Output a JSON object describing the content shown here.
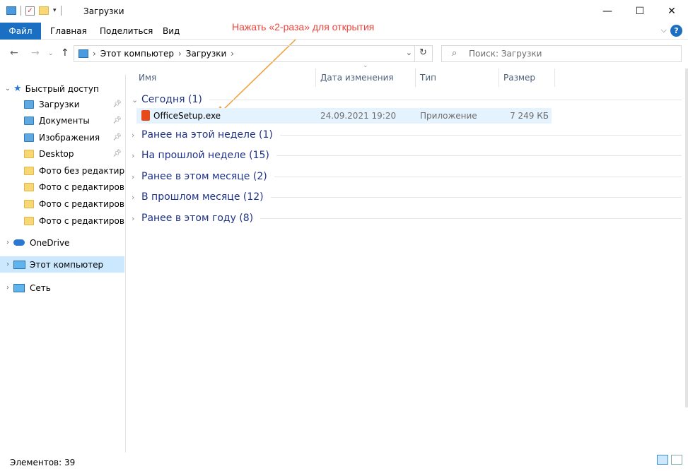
{
  "window": {
    "title": "Загрузки"
  },
  "window_buttons": {
    "minimize": "—",
    "maximize": "☐",
    "close": "✕"
  },
  "ribbon": {
    "tabs": [
      "Файл",
      "Главная",
      "Поделиться",
      "Вид"
    ]
  },
  "annotation": {
    "text": "Нажать «2-раза» для открытия",
    "color": "#f0433b"
  },
  "address": {
    "crumbs": [
      "Этот компьютер",
      "Загрузки"
    ]
  },
  "search": {
    "placeholder": "Поиск: Загрузки"
  },
  "sidebar": {
    "quick_access": "Быстрый доступ",
    "items": [
      {
        "label": "Загрузки",
        "pinned": true
      },
      {
        "label": "Документы",
        "pinned": true
      },
      {
        "label": "Изображения",
        "pinned": true
      },
      {
        "label": "Desktop",
        "pinned": true
      },
      {
        "label": "Фото без редактирования",
        "pinned": false
      },
      {
        "label": "Фото с редактированием",
        "pinned": false
      },
      {
        "label": "Фото с редактированием",
        "pinned": false
      },
      {
        "label": "Фото с редактированием",
        "pinned": false
      }
    ],
    "onedrive": "OneDrive",
    "this_pc": "Этот компьютер",
    "network": "Сеть"
  },
  "columns": {
    "name": "Имя",
    "date": "Дата изменения",
    "type": "Тип",
    "size": "Размер"
  },
  "groups": [
    {
      "label": "Сегодня (1)",
      "expanded": true
    },
    {
      "label": "Ранее на этой неделе (1)",
      "expanded": false
    },
    {
      "label": "На прошлой неделе (15)",
      "expanded": false
    },
    {
      "label": "Ранее в этом месяце (2)",
      "expanded": false
    },
    {
      "label": "В прошлом месяце (12)",
      "expanded": false
    },
    {
      "label": "Ранее в этом году (8)",
      "expanded": false
    }
  ],
  "file": {
    "name": "OfficeSetup.exe",
    "date": "24.09.2021 19:20",
    "type": "Приложение",
    "size": "7 249 КБ"
  },
  "status": {
    "items": "Элементов: 39"
  },
  "colors": {
    "accent": "#1a6fc2",
    "selection": "#cce8ff",
    "group_text": "#1e3287"
  }
}
